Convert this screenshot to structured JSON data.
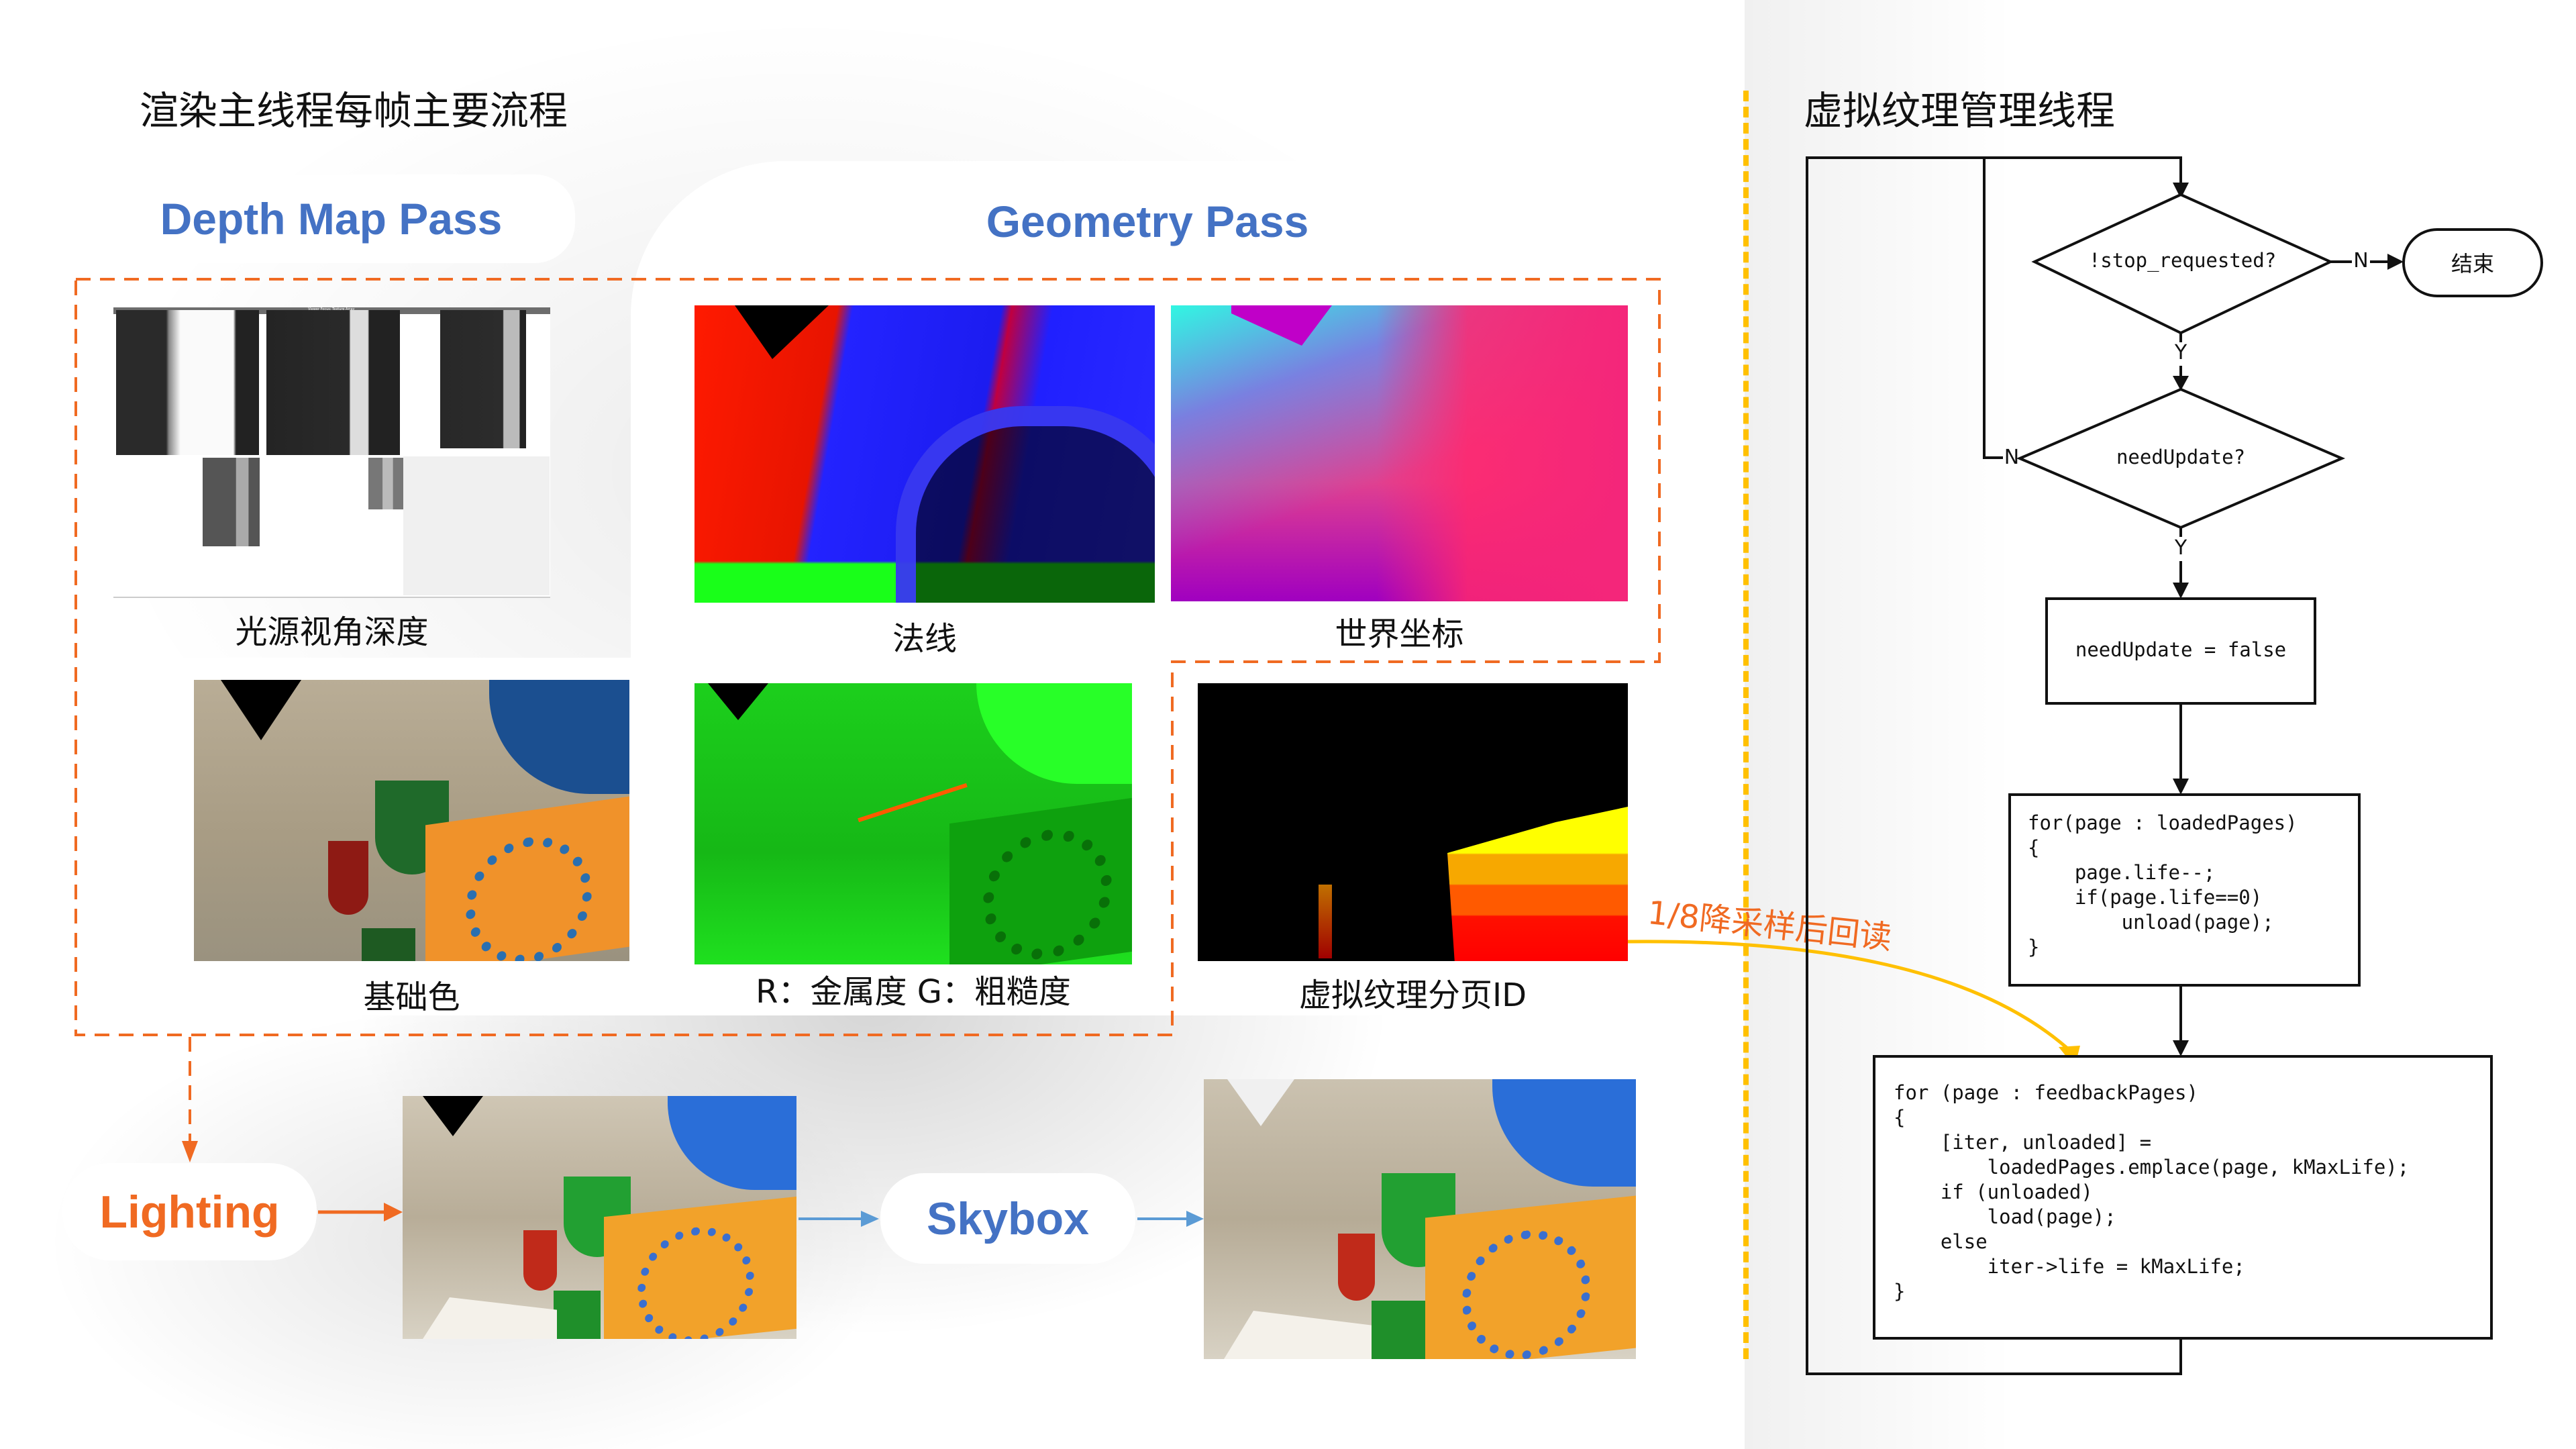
{
  "left": {
    "title": "渲染主线程每帧主要流程",
    "depth_pass": {
      "label": "Depth Map Pass",
      "image_caption": "光源视角深度",
      "image_header_text": "Viewer Focus: Texture Array"
    },
    "geometry_pass": {
      "label": "Geometry Pass",
      "images": [
        {
          "caption": "法线",
          "kind": "normal-buffer"
        },
        {
          "caption": "世界坐标",
          "kind": "world-position-buffer"
        },
        {
          "caption": "基础色",
          "kind": "base-color-buffer"
        },
        {
          "caption": "R：金属度  G：粗糙度",
          "kind": "metallic-roughness-buffer"
        },
        {
          "caption": "虚拟纹理分页ID",
          "kind": "vt-page-id-buffer"
        }
      ]
    },
    "lighting": {
      "label": "Lighting"
    },
    "skybox": {
      "label": "Skybox"
    },
    "readback_label": "1/8降采样后回读"
  },
  "right": {
    "title": "虚拟纹理管理线程",
    "flowchart": {
      "decision_stop": "!stop_requested?",
      "decision_update": "needUpdate?",
      "end_label": "结束",
      "yes_label": "Y",
      "no_label": "N",
      "assign_box": "needUpdate = false",
      "loaded_loop": [
        "for(page : loadedPages)",
        "{",
        "    page.life--;",
        "    if(page.life==0)",
        "        unload(page);",
        "}"
      ],
      "feedback_loop": [
        "for (page : feedbackPages)",
        "{",
        "    [iter, unloaded] =",
        "        loadedPages.emplace(page, kMaxLife);",
        "    if (unloaded)",
        "        load(page);",
        "    else",
        "        iter->life = kMaxLife;",
        "}"
      ]
    }
  },
  "colors": {
    "pass_blue": "#4472c4",
    "lighting_orange": "#f06a22",
    "divider_yellow": "#ffc000",
    "arrow_blue": "#5b9bd5"
  }
}
